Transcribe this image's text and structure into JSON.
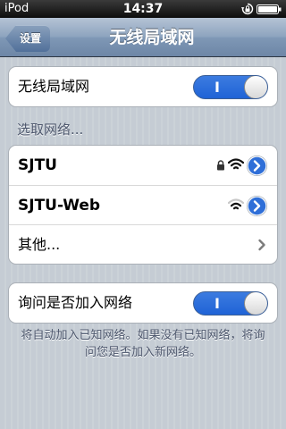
{
  "status_bar": {
    "carrier": "iPod",
    "time": "14:37",
    "icons": [
      "lock-rotation-icon",
      "battery-icon"
    ]
  },
  "nav_bar": {
    "back_label": "设置",
    "title": "无线局域网"
  },
  "wifi_toggle": {
    "label": "无线局域网",
    "state_text": "I",
    "on": true
  },
  "network_section": {
    "header": "选取网络...",
    "networks": [
      {
        "name": "SJTU",
        "secured": true,
        "icons": [
          "lock-icon",
          "wifi-signal-icon",
          "detail-disclosure-icon"
        ]
      },
      {
        "name": "SJTU-Web",
        "secured": false,
        "icons": [
          "wifi-signal-icon",
          "detail-disclosure-icon"
        ]
      }
    ],
    "other_label": "其他..."
  },
  "ask_join": {
    "label": "询问是否加入网络",
    "state_text": "I",
    "on": true,
    "footer": "将自动加入已知网络。如果没有已知网络，将询问您是否加入新网络。"
  },
  "colors": {
    "toggle_on": "#2a6fdb",
    "nav_bar": "#7f98b6",
    "background": "#c5ccd4",
    "detail_blue": "#2f6fd8"
  }
}
